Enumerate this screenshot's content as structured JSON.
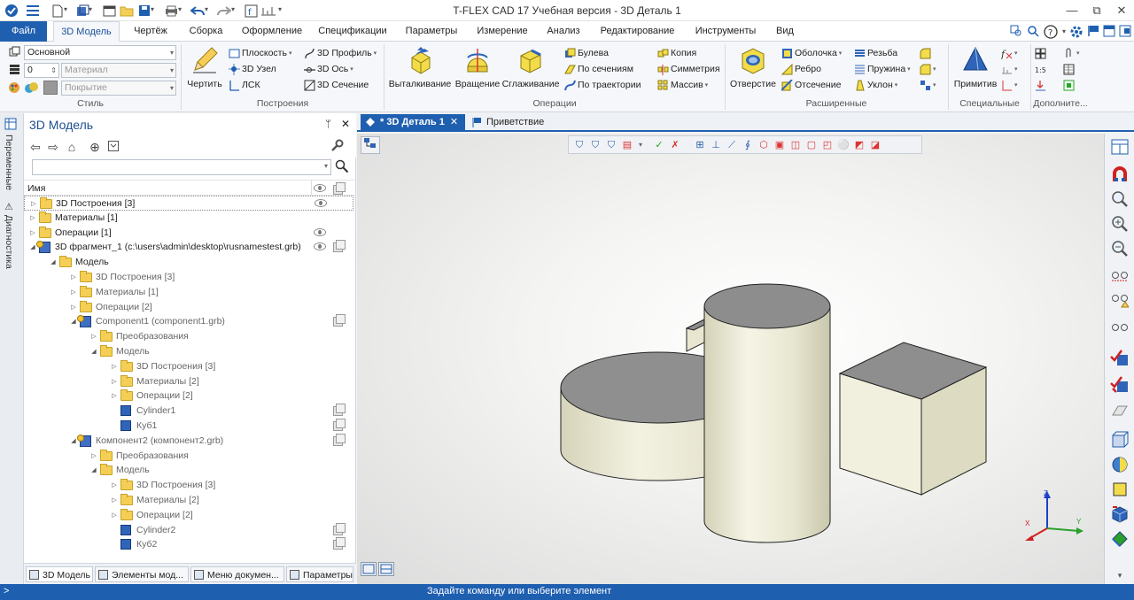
{
  "app": {
    "title": "T-FLEX CAD 17 Учебная версия - 3D Деталь 1"
  },
  "window_controls": {
    "minimize": "—",
    "restore": "⧉",
    "close": "✕"
  },
  "ribbon_tabs": [
    "Файл",
    "3D Модель",
    "Чертёж",
    "Сборка",
    "Оформление",
    "Спецификации",
    "Параметры",
    "Измерение",
    "Анализ",
    "Редактирование",
    "Инструменты",
    "Вид"
  ],
  "active_tab": "3D Модель",
  "groups": {
    "style": {
      "label": "Стиль",
      "layer": "Основной",
      "level": "0",
      "material_placeholder": "Материал",
      "cover_placeholder": "Покрытие"
    },
    "constructions": {
      "label": "Построения",
      "big_button": "Чертить",
      "items": [
        "Плоскость",
        "3D Профиль",
        "3D Узел",
        "3D Ось",
        "ЛСК",
        "3D Сечение"
      ]
    },
    "operations": {
      "label": "Операции",
      "big_buttons": [
        "Выталкивание",
        "Вращение",
        "Сглаживание"
      ],
      "items": [
        "Булева",
        "Копия",
        "По сечениям",
        "Симметрия",
        "По траектории",
        "Массив"
      ]
    },
    "extended": {
      "label": "Расширенные",
      "big_button": "Отверстие",
      "items": [
        "Оболочка",
        "Резьба",
        "Ребро",
        "Пружина",
        "Отсечение",
        "Уклон"
      ]
    },
    "special": {
      "label": "Специальные",
      "big_button": "Примитив"
    },
    "additional": {
      "label": "Дополните..."
    }
  },
  "panel": {
    "title": "3D Модель",
    "pin": "ᛘ",
    "close": "✕",
    "column_name": "Имя",
    "tree": [
      {
        "level": 0,
        "type": "folder",
        "expand": "▷",
        "label": "3D Построения [3]",
        "eye": true,
        "selected": true
      },
      {
        "level": 0,
        "type": "folder",
        "expand": "▷",
        "label": "Материалы [1]"
      },
      {
        "level": 0,
        "type": "folder",
        "expand": "▷",
        "label": "Операции [1]",
        "eye": true
      },
      {
        "level": 0,
        "type": "fragment",
        "expand": "◢",
        "label": "3D фрагмент_1 (c:\\users\\admin\\desktop\\rusnamestest.grb)",
        "eye": true,
        "copy": true
      },
      {
        "level": 1,
        "type": "folder",
        "expand": "◢",
        "label": "Модель"
      },
      {
        "level": 2,
        "type": "folder",
        "expand": "▷",
        "label": "3D Построения [3]",
        "grey": true
      },
      {
        "level": 2,
        "type": "folder",
        "expand": "▷",
        "label": "Материалы [1]",
        "grey": true
      },
      {
        "level": 2,
        "type": "folder",
        "expand": "▷",
        "label": "Операции [2]",
        "grey": true
      },
      {
        "level": 2,
        "type": "fragment",
        "expand": "◢",
        "label": "Component1 (component1.grb)",
        "grey": true,
        "copy": true
      },
      {
        "level": 3,
        "type": "folder",
        "expand": "▷",
        "label": "Преобразования",
        "grey": true
      },
      {
        "level": 3,
        "type": "folder",
        "expand": "◢",
        "label": "Модель",
        "grey": true
      },
      {
        "level": 4,
        "type": "folder",
        "expand": "▷",
        "label": "3D Построения [3]",
        "grey": true
      },
      {
        "level": 4,
        "type": "folder",
        "expand": "▷",
        "label": "Материалы [2]",
        "grey": true
      },
      {
        "level": 4,
        "type": "folder",
        "expand": "▷",
        "label": "Операции [2]",
        "grey": true
      },
      {
        "level": 4,
        "type": "body",
        "expand": "",
        "label": "Cylinder1",
        "grey": true,
        "copy": true
      },
      {
        "level": 4,
        "type": "body",
        "expand": "",
        "label": "Куб1",
        "grey": true,
        "copy": true
      },
      {
        "level": 2,
        "type": "fragment",
        "expand": "◢",
        "label": "Компонент2 (компонент2.grb)",
        "grey": true,
        "copy": true
      },
      {
        "level": 3,
        "type": "folder",
        "expand": "▷",
        "label": "Преобразования",
        "grey": true
      },
      {
        "level": 3,
        "type": "folder",
        "expand": "◢",
        "label": "Модель",
        "grey": true
      },
      {
        "level": 4,
        "type": "folder",
        "expand": "▷",
        "label": "3D Построения [3]",
        "grey": true
      },
      {
        "level": 4,
        "type": "folder",
        "expand": "▷",
        "label": "Материалы [2]",
        "grey": true
      },
      {
        "level": 4,
        "type": "folder",
        "expand": "▷",
        "label": "Операции [2]",
        "grey": true
      },
      {
        "level": 4,
        "type": "body",
        "expand": "",
        "label": "Cylinder2",
        "grey": true,
        "copy": true
      },
      {
        "level": 4,
        "type": "body",
        "expand": "",
        "label": "Куб2",
        "grey": true,
        "copy": true
      }
    ],
    "bottom_tabs": [
      "3D Модель",
      "Элементы мод...",
      "Меню докумен...",
      "Параметры"
    ]
  },
  "side_tabs": [
    "Переменные",
    "Диагностика"
  ],
  "doc_tabs": [
    {
      "label": "* 3D Деталь 1",
      "close": "✕",
      "active": true
    },
    {
      "label": "Приветствие",
      "active": false
    }
  ],
  "axes": {
    "x": "X",
    "y": "Y",
    "z": "Z"
  },
  "status": {
    "prompt": ">",
    "message": "Задайте команду или выберите элемент"
  },
  "colors": {
    "accent": "#1f5fb0",
    "object_side": "#ecebd8",
    "object_top": "#8e8e8e"
  }
}
